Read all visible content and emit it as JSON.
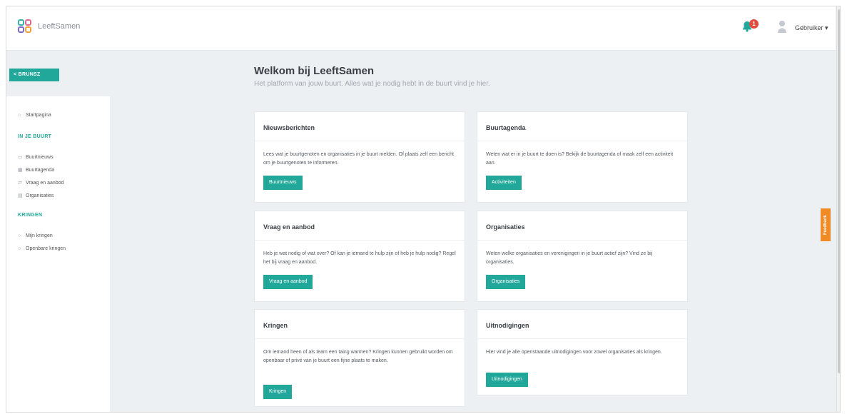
{
  "header": {
    "app_name": "LeeftSamen",
    "notification_count": "1",
    "username": "Gebruiker"
  },
  "sidebar": {
    "back_label": "< BRUNSZ",
    "items_top": [
      {
        "label": "Startpagina"
      }
    ],
    "section_buurt": "IN JE BUURT",
    "items_buurt": [
      {
        "label": "Buurtnieuws"
      },
      {
        "label": "Buurtagenda"
      },
      {
        "label": "Vraag en aanbod"
      },
      {
        "label": "Organisaties"
      }
    ],
    "section_kringen": "KRINGEN",
    "items_kringen": [
      {
        "label": "Mijn kringen"
      },
      {
        "label": "Openbare kringen"
      }
    ]
  },
  "main": {
    "title": "Welkom bij LeeftSamen",
    "subtitle": "Het platform van jouw buurt. Alles wat je nodig hebt in de buurt vind je hier.",
    "cards": [
      {
        "title": "Nieuwsberichten",
        "text": "Lees wat je buurtgenoten en organisaties in je buurt melden. Of plaats zelf een bericht om je buurtgenoten te informeren.",
        "button": "Buurtnieuws"
      },
      {
        "title": "Buurtagenda",
        "text": "Weten wat er in je buurt te doen is? Bekijk de buurtagenda of maak zelf een activiteit aan.",
        "button": "Activiteiten"
      },
      {
        "title": "Vraag en aanbod",
        "text": "Heb je wat nodig of wat over? Of kan je iemand te hulp zijn of heb je hulp nodig? Regel het bij vraag en aanbod.",
        "button": "Vraag en aanbod"
      },
      {
        "title": "Organisaties",
        "text": "Weten welke organisaties en verenigingen in je buurt actief zijn? Vind ze bij organisaties.",
        "button": "Organisaties"
      },
      {
        "title": "Kringen",
        "text": "Om iemand heen of als team een taing warmen? Kringen kunnen gebruikt worden om openbaar of privé van je buurt een fijne plaats te maken.",
        "button": "Kringen"
      },
      {
        "title": "Uitnodigingen",
        "text": "Hier vind je alle openstaande uitnodigingen voor zowel organisaties als kringen.",
        "button": "Uitnodigingen"
      }
    ]
  },
  "feedback_tab": "Feedback",
  "colors": {
    "accent": "#21a89a",
    "badge": "#e34b3d",
    "feedback": "#f08a24"
  }
}
